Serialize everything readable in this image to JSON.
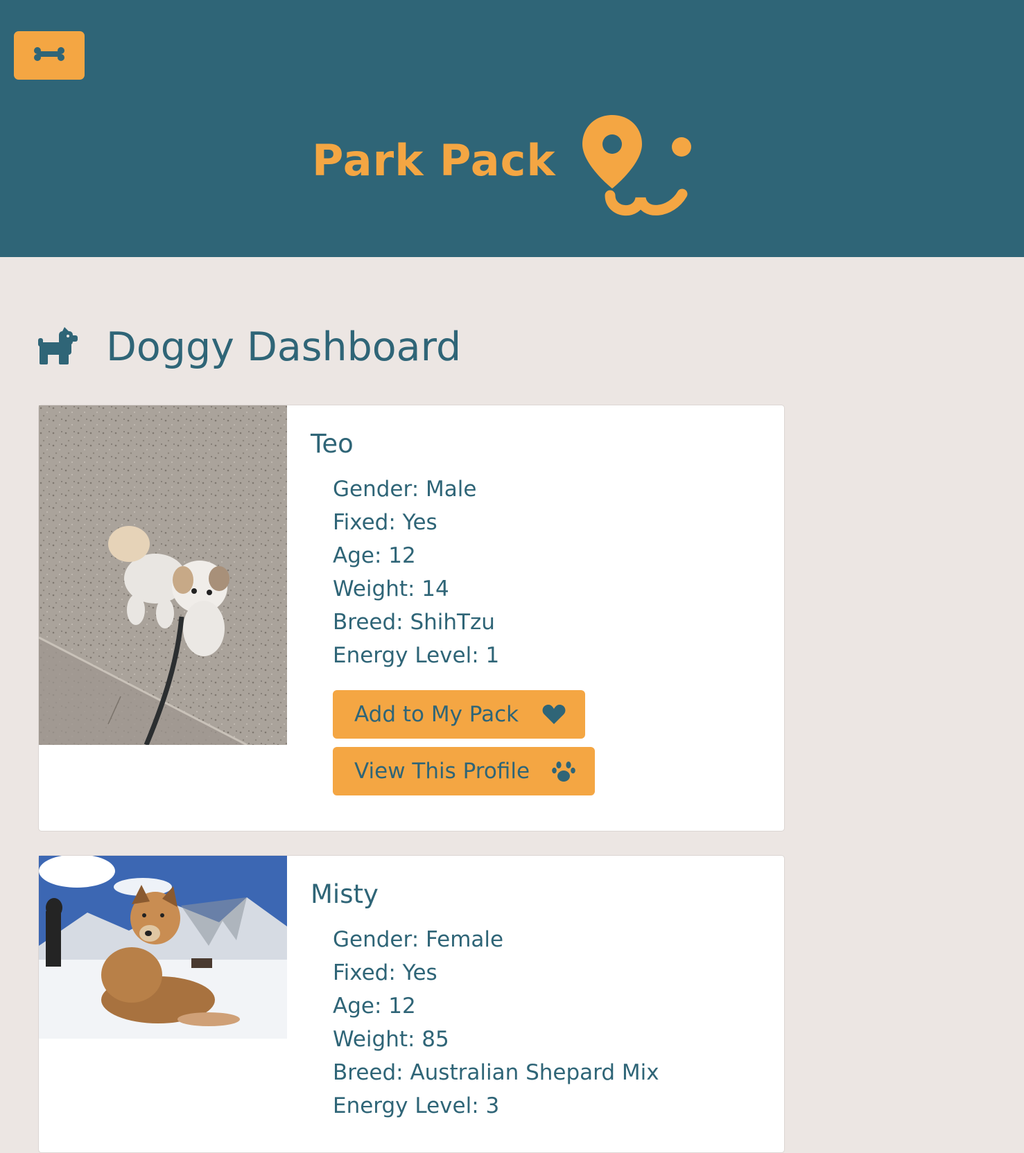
{
  "header": {
    "menu_icon": "bone-icon",
    "brand_title": "Park Pack",
    "logo_icon": "map-pin-dog-face-logo",
    "colors": {
      "background": "#2f6577",
      "accent": "#f4a643"
    }
  },
  "dashboard": {
    "title": "Doggy Dashboard",
    "title_icon": "dog-icon"
  },
  "dogs": [
    {
      "name": "Teo",
      "gender": "Gender: Male",
      "fixed": "Fixed: Yes",
      "age": "Age: 12",
      "weight": "Weight: 14",
      "breed": "Breed: ShihTzu",
      "energy": "Energy Level: 1",
      "add_label": "Add to My Pack",
      "add_icon": "heart-icon",
      "view_label": "View This Profile",
      "view_icon": "paw-icon"
    },
    {
      "name": "Misty",
      "gender": "Gender: Female",
      "fixed": "Fixed: Yes",
      "age": "Age: 12",
      "weight": "Weight: 85",
      "breed": "Breed: Australian Shepard Mix",
      "energy": "Energy Level: 3"
    }
  ]
}
